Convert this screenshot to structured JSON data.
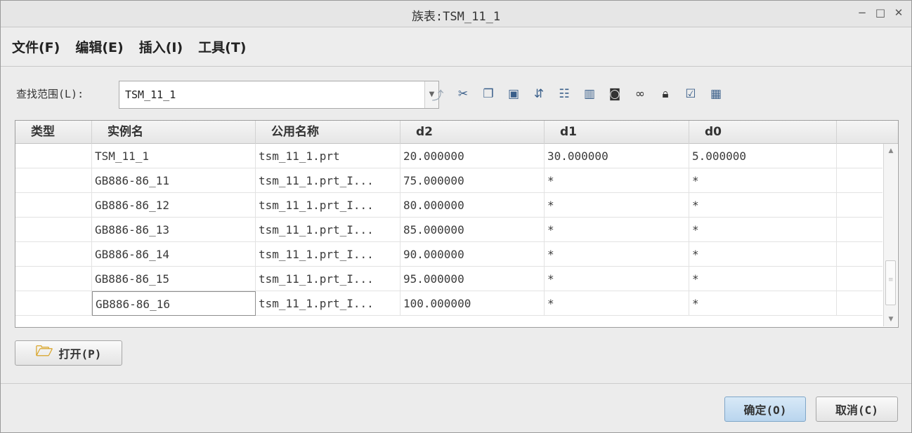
{
  "window": {
    "title": "族表:TSM_11_1",
    "controls": [
      "−",
      "□",
      "✕"
    ]
  },
  "menu": [
    {
      "label": "文件(F)"
    },
    {
      "label": "编辑(E)"
    },
    {
      "label": "插入(I)"
    },
    {
      "label": "工具(T)"
    }
  ],
  "search": {
    "label": "查找范围(L):",
    "value": "TSM_11_1"
  },
  "toolbar": {
    "icons": [
      "parent-level-icon",
      "cut-icon",
      "copy-icon",
      "paste-icon",
      "insert-column-icon",
      "insert-row-icon",
      "column-info-icon",
      "find-icon",
      "preview-icon",
      "lock-icon",
      "verify-icon",
      "table-icon"
    ]
  },
  "table": {
    "headers": [
      "类型",
      "实例名",
      "公用名称",
      "d2",
      "d1",
      "d0"
    ],
    "rows": [
      [
        "",
        "TSM_11_1",
        "tsm_11_1.prt",
        "20.000000",
        "30.000000",
        "5.000000"
      ],
      [
        "",
        "GB886-86_11",
        "tsm_11_1.prt_I...",
        "75.000000",
        "*",
        "*"
      ],
      [
        "",
        "GB886-86_12",
        "tsm_11_1.prt_I...",
        "80.000000",
        "*",
        "*"
      ],
      [
        "",
        "GB886-86_13",
        "tsm_11_1.prt_I...",
        "85.000000",
        "*",
        "*"
      ],
      [
        "",
        "GB886-86_14",
        "tsm_11_1.prt_I...",
        "90.000000",
        "*",
        "*"
      ],
      [
        "",
        "GB886-86_15",
        "tsm_11_1.prt_I...",
        "95.000000",
        "*",
        "*"
      ],
      [
        "",
        "GB886-86_16",
        "tsm_11_1.prt_I...",
        "100.000000",
        "*",
        "*"
      ]
    ]
  },
  "buttons": {
    "open": "打开(P)",
    "ok": "确定(O)",
    "cancel": "取消(C)"
  }
}
